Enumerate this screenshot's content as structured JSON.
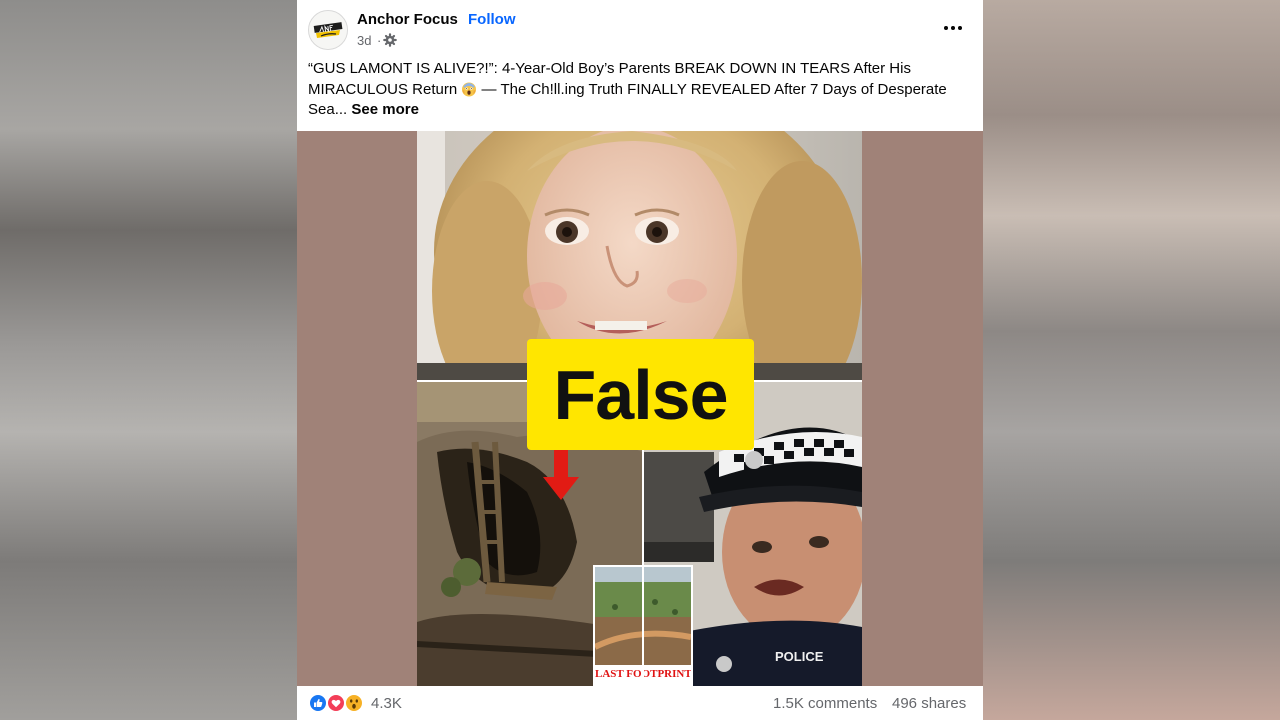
{
  "post": {
    "page_name": "Anchor Focus",
    "separator": "·",
    "follow_label": "Follow",
    "time": "3d",
    "time_separator": "·",
    "privacy_icon": "gear-icon",
    "more_icon": "more-icon",
    "avatar_logo_text": "ANCHOR FOCUS",
    "caption": {
      "part1": "“GUS LAMONT IS ALIVE?!”: 4-Year-Old Boy’s Parents BREAK DOWN IN TEARS After His MIRACULOUS Return ",
      "emoji": "face-screaming-in-fear-emoji",
      "part2": " — The Ch!ll.ing Truth FINALLY REVEALED After 7 Days of Desperate Sea...",
      "see_more": "See more"
    }
  },
  "media": {
    "badge_text": "False",
    "inset_caption": "LAST FOOTPRINT",
    "police_cap_text": "POLICE",
    "badge_color": "#ffe600",
    "background_color": "#a08278"
  },
  "footer": {
    "reaction_icons": [
      "like-icon",
      "love-icon",
      "wow-icon"
    ],
    "reaction_count": "4.3K",
    "comments": "1.5K comments",
    "shares": "496 shares"
  },
  "colors": {
    "link_blue": "#0866ff",
    "secondary_text": "#65676b",
    "primary_text": "#050505"
  }
}
